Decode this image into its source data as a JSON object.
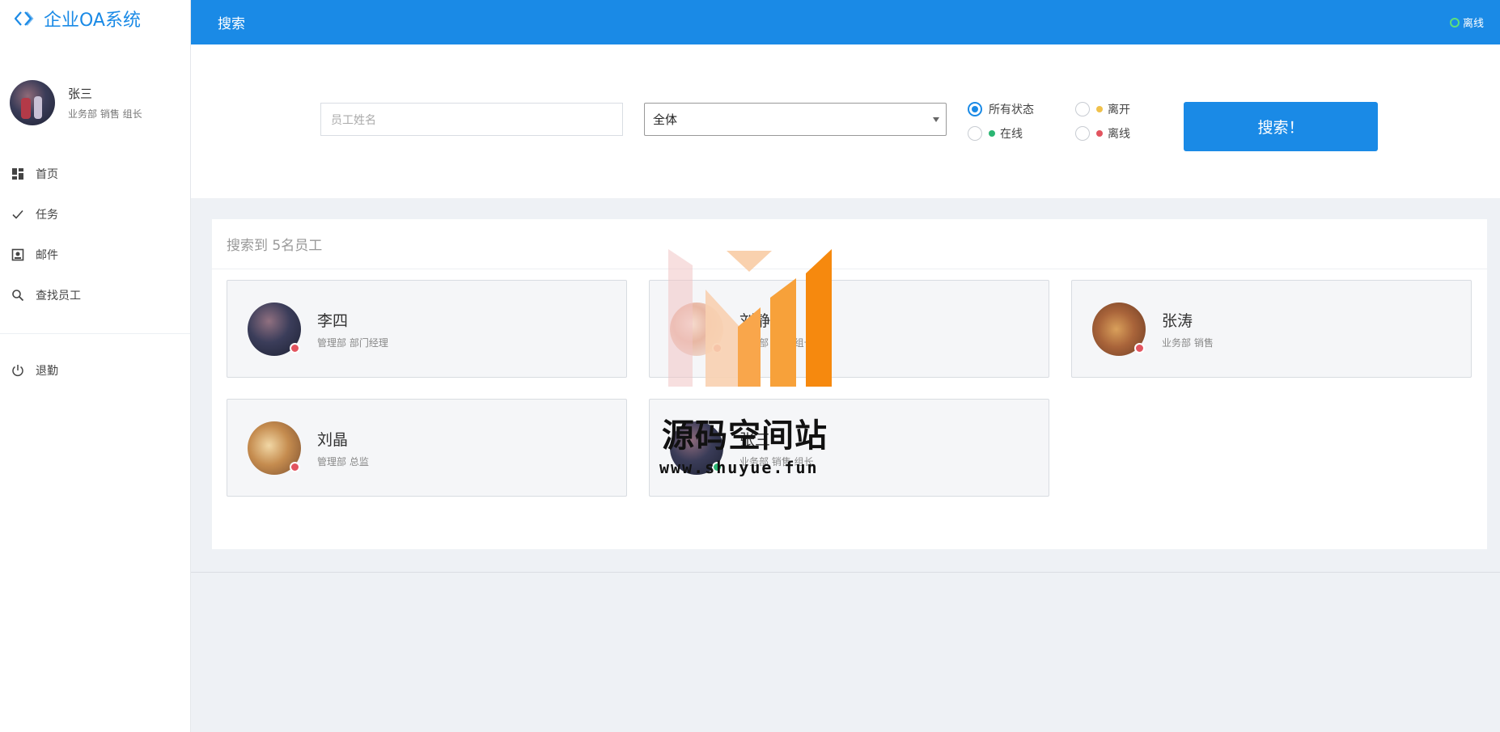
{
  "app": {
    "title": "企业OA系统"
  },
  "user": {
    "name": "张三",
    "dept": "业务部 销售 组长"
  },
  "nav": {
    "items": [
      {
        "label": "首页",
        "icon": "dashboard-icon"
      },
      {
        "label": "任务",
        "icon": "check-icon"
      },
      {
        "label": "邮件",
        "icon": "mail-icon"
      },
      {
        "label": "查找员工",
        "icon": "search-icon"
      }
    ],
    "logout": {
      "label": "退勤",
      "icon": "power-icon"
    }
  },
  "header": {
    "title": "搜索",
    "status": "离线",
    "status_color": "#5ee07a"
  },
  "search": {
    "name_placeholder": "员工姓名",
    "dept_value": "全体",
    "statuses": [
      {
        "label": "所有状态",
        "checked": true,
        "dot": ""
      },
      {
        "label": "离开",
        "checked": false,
        "dot": "#f0c14b"
      },
      {
        "label": "在线",
        "checked": false,
        "dot": "#2bb673"
      },
      {
        "label": "离线",
        "checked": false,
        "dot": "#e2545f"
      }
    ],
    "button_label": "搜索！"
  },
  "results": {
    "summary": "搜索到 5名员工",
    "employees": [
      {
        "name": "李四",
        "dept": "管理部 部门经理",
        "status_color": "#e2545f"
      },
      {
        "name": "刘静",
        "dept": "管理部 销售 组长",
        "status_color": "#e2545f"
      },
      {
        "name": "张涛",
        "dept": "业务部 销售",
        "status_color": "#e2545f"
      },
      {
        "name": "刘晶",
        "dept": "管理部 总监",
        "status_color": "#e2545f"
      },
      {
        "name": "张三",
        "dept": "业务部 销售 组长",
        "status_color": "#2bb673"
      }
    ]
  },
  "watermark": {
    "text": "源码空间站",
    "url": "www.shuyue.fun"
  },
  "colors": {
    "primary": "#1a8ae6",
    "offline": "#e2545f",
    "online": "#2bb673",
    "away": "#f0c14b"
  }
}
